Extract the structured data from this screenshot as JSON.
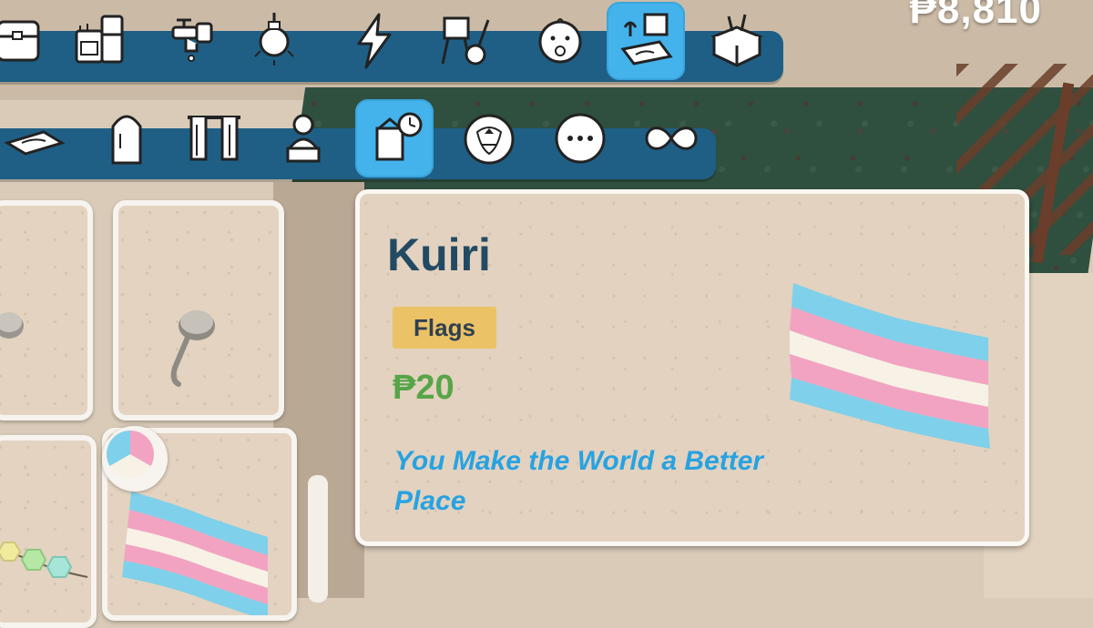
{
  "currency": {
    "amount": "₱8,810"
  },
  "category_bar": {
    "items": [
      {
        "icon": "storage-chest-icon",
        "selected": false
      },
      {
        "icon": "kitchen-appliances-icon",
        "selected": false
      },
      {
        "icon": "faucet-icon",
        "selected": false
      },
      {
        "icon": "light-bulb-icon",
        "selected": false
      },
      {
        "icon": "lightning-bolt-icon",
        "selected": false
      },
      {
        "icon": "easel-guitar-icon",
        "selected": false
      },
      {
        "icon": "baby-face-icon",
        "selected": false
      },
      {
        "icon": "decor-rug-icon",
        "selected": true
      },
      {
        "icon": "open-box-icon",
        "selected": false
      }
    ]
  },
  "subcategory_bar": {
    "items": [
      {
        "icon": "rug-icon",
        "selected": false
      },
      {
        "icon": "mirror-icon",
        "selected": false
      },
      {
        "icon": "curtains-icon",
        "selected": false
      },
      {
        "icon": "bust-statue-icon",
        "selected": false
      },
      {
        "icon": "wall-hanging-clock-icon",
        "selected": true
      },
      {
        "icon": "pumpkin-icon",
        "selected": false
      },
      {
        "icon": "more-dots-icon",
        "selected": false
      },
      {
        "icon": "infinity-icon",
        "selected": false
      }
    ]
  },
  "grid_items": [
    {
      "icon": "wall-hook-icon"
    },
    {
      "icon": "wall-hook-icon"
    },
    {
      "icon": "hexagon-garland-icon"
    },
    {
      "icon": "flag-icon"
    }
  ],
  "colors": {
    "bar": "#1f5f86",
    "selected": "#44b3ec",
    "name": "#234a63",
    "tag": "#ecc266",
    "price": "#57a548",
    "description": "#27a2e2",
    "flag_blue": "#7fd0ea",
    "flag_pink": "#f2a3c2",
    "flag_white": "#f7f1e6"
  },
  "tooltip": {
    "name": "Kuiri",
    "category": "Flags",
    "price": "₱20",
    "description": "You Make the World a Better Place"
  }
}
